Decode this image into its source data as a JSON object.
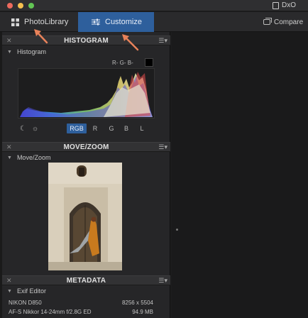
{
  "window": {
    "title": "DxO"
  },
  "toolbar": {
    "tabs": [
      {
        "label": "PhotoLibrary",
        "icon": "grid-icon"
      },
      {
        "label": "Customize",
        "icon": "sliders-icon"
      }
    ],
    "compare_label": "Compare"
  },
  "histogram": {
    "header": "HISTOGRAM",
    "sub_label": "Histogram",
    "rgb_readout": "R- G- B-",
    "channels": [
      "RGB",
      "R",
      "G",
      "B",
      "L"
    ],
    "active_channel": "RGB"
  },
  "movezoom": {
    "header": "MOVE/ZOOM",
    "sub_label": "Move/Zoom"
  },
  "metadata": {
    "header": "METADATA",
    "sub_label": "Exif Editor",
    "rows": [
      {
        "left": "NIKON D850",
        "right": "8256 x 5504"
      },
      {
        "left": "AF-S Nikkor 14-24mm f/2.8G ED",
        "right": "94.9 MB"
      }
    ]
  },
  "colors": {
    "accent": "#2e5f9c",
    "arrow": "#e8825a"
  }
}
